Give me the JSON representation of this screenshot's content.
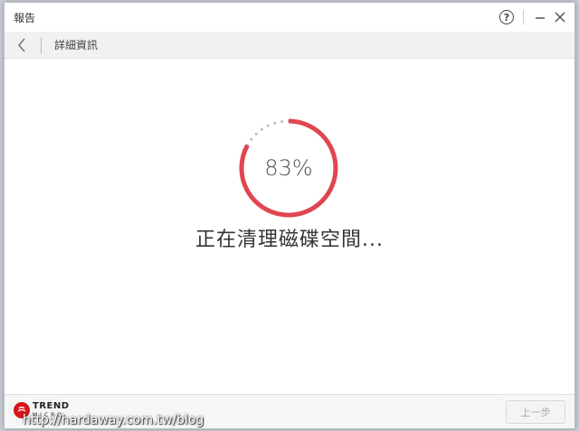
{
  "window": {
    "title": "報告"
  },
  "nav": {
    "title": "詳細資訊"
  },
  "progress": {
    "percent_label": "83%",
    "value": 0.83,
    "accent_color": "#e0464f",
    "status_text": "正在清理磁碟空間..."
  },
  "footer": {
    "logo_top": "TREND",
    "logo_bottom": "MICRO",
    "watermark": "http://hardaway.com.tw/blog",
    "prev_button_label": "上一步"
  },
  "icons": {
    "help": "help-icon",
    "minimize": "minimize-icon",
    "close": "close-icon",
    "back": "chevron-left-icon",
    "logo": "trend-micro-logo-icon"
  }
}
